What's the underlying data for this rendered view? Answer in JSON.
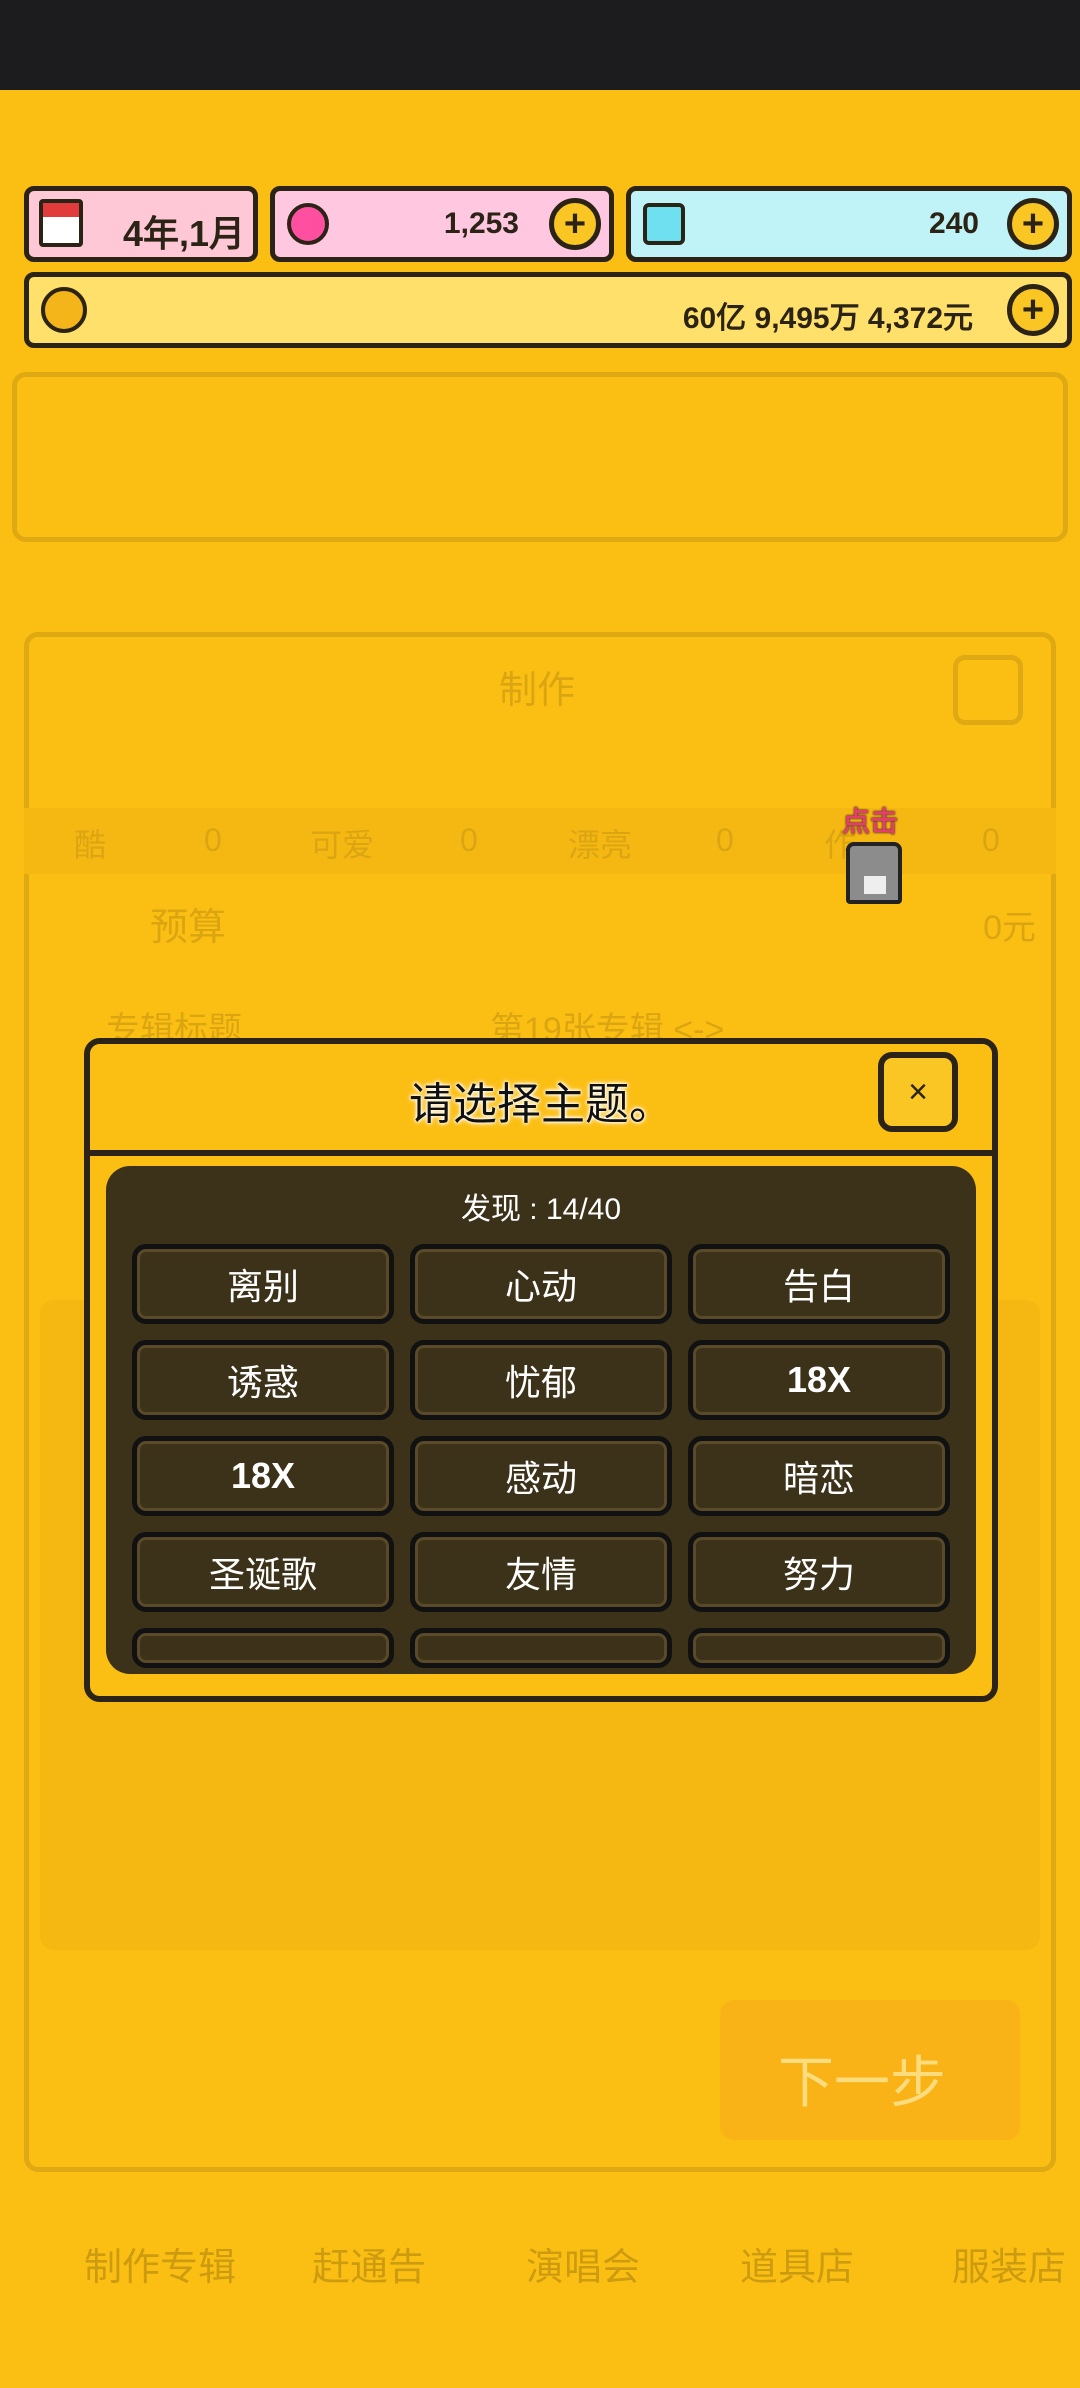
{
  "status": {
    "date": "4年,1月",
    "pink_currency": "1,253",
    "gems": "240",
    "money": "60亿 9,495万 4,372元"
  },
  "background": {
    "produce_title": "制作",
    "attrs": [
      {
        "label": "酷",
        "value": "0"
      },
      {
        "label": "可爱",
        "value": "0"
      },
      {
        "label": "漂亮",
        "value": "0"
      },
      {
        "label": "作",
        "value": "0"
      }
    ],
    "budget_label": "预算",
    "budget_value": "0元",
    "album_label": "专辑标题",
    "album_value": "第19张专辑 <->",
    "next_label": "下一步",
    "nav": [
      "制作专辑",
      "赶通告",
      "演唱会",
      "道具店",
      "服装店"
    ],
    "tap_label": "点击"
  },
  "modal": {
    "title": "请选择主题。",
    "close": "×",
    "found": "发现 : 14/40",
    "themes": [
      "离别",
      "心动",
      "告白",
      "诱惑",
      "忧郁",
      "18X",
      "18X",
      "感动",
      "暗恋",
      "圣诞歌",
      "友情",
      "努力"
    ]
  },
  "colors": {
    "primary": "#fbbf14",
    "panel": "#3c3119",
    "dark": "#2b2416"
  }
}
